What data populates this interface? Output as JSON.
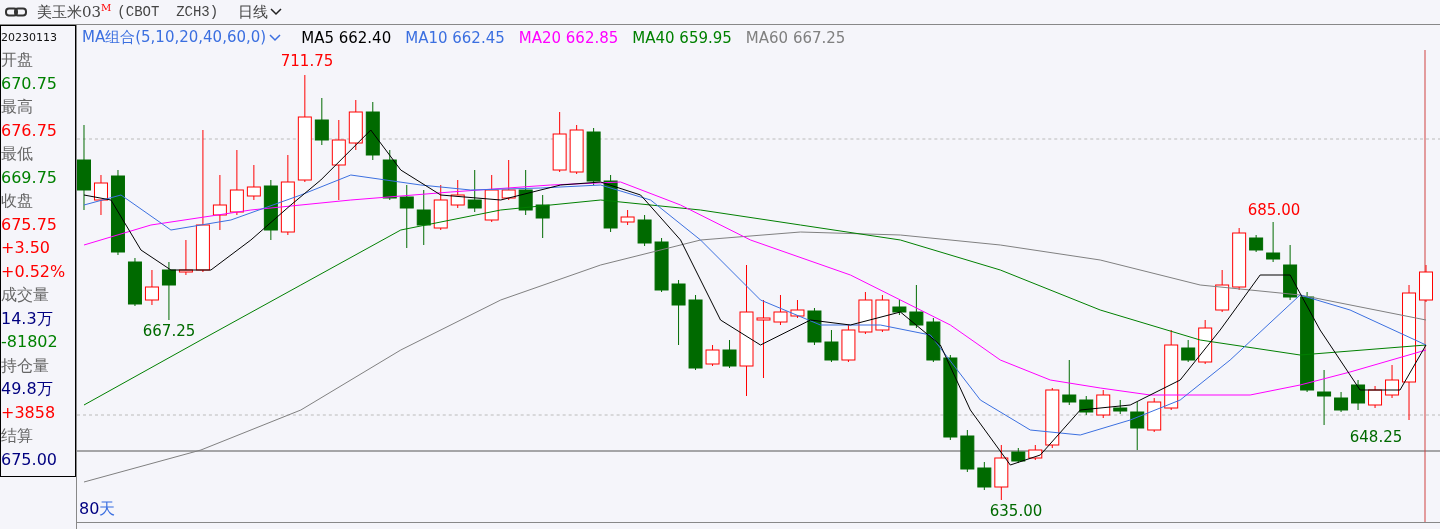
{
  "header": {
    "instrument": "美玉米03",
    "flag": "M",
    "code": "(CBOT  ZCH3)",
    "period": "日线"
  },
  "info_panel": {
    "date": "20230113",
    "rows": [
      {
        "kind": "label",
        "text": "开盘"
      },
      {
        "kind": "value",
        "text": "670.75",
        "color": "#008000"
      },
      {
        "kind": "label",
        "text": "最高"
      },
      {
        "kind": "value",
        "text": "676.75",
        "color": "#ff0000"
      },
      {
        "kind": "label",
        "text": "最低"
      },
      {
        "kind": "value",
        "text": "669.75",
        "color": "#008000"
      },
      {
        "kind": "label",
        "text": "收盘"
      },
      {
        "kind": "value",
        "text": "675.75",
        "color": "#ff0000"
      },
      {
        "kind": "value",
        "text": "+3.50",
        "color": "#ff0000"
      },
      {
        "kind": "value",
        "text": "+0.52%",
        "color": "#ff0000"
      },
      {
        "kind": "label",
        "text": "成交量"
      },
      {
        "kind": "value",
        "text": "14.3万",
        "color": "#000080"
      },
      {
        "kind": "value",
        "text": "-81802",
        "color": "#008000"
      },
      {
        "kind": "label",
        "text": "持仓量"
      },
      {
        "kind": "value",
        "text": "49.8万",
        "color": "#000080"
      },
      {
        "kind": "value",
        "text": "+3858",
        "color": "#ff0000"
      },
      {
        "kind": "label",
        "text": "结算"
      },
      {
        "kind": "value",
        "text": "675.00",
        "color": "#000080"
      }
    ]
  },
  "ma_legend": {
    "selector": "MA组合(5,10,20,40,60,0)",
    "lines": [
      {
        "name": "MA5",
        "value": "662.40",
        "color": "#000000"
      },
      {
        "name": "MA10",
        "value": "662.45",
        "color": "#3b6fe0"
      },
      {
        "name": "MA20",
        "value": "662.85",
        "color": "#ff00ff"
      },
      {
        "name": "MA40",
        "value": "659.95",
        "color": "#008000"
      },
      {
        "name": "MA60",
        "value": "667.25",
        "color": "#808080"
      }
    ]
  },
  "price_labels": [
    {
      "kind": "high",
      "text": "711.75"
    },
    {
      "kind": "low",
      "text": "667.25"
    },
    {
      "kind": "low",
      "text": "635.00"
    },
    {
      "kind": "high",
      "text": "685.00"
    },
    {
      "kind": "low",
      "text": "648.25"
    }
  ],
  "range_label": {
    "number": "80",
    "unit": "天"
  }
}
